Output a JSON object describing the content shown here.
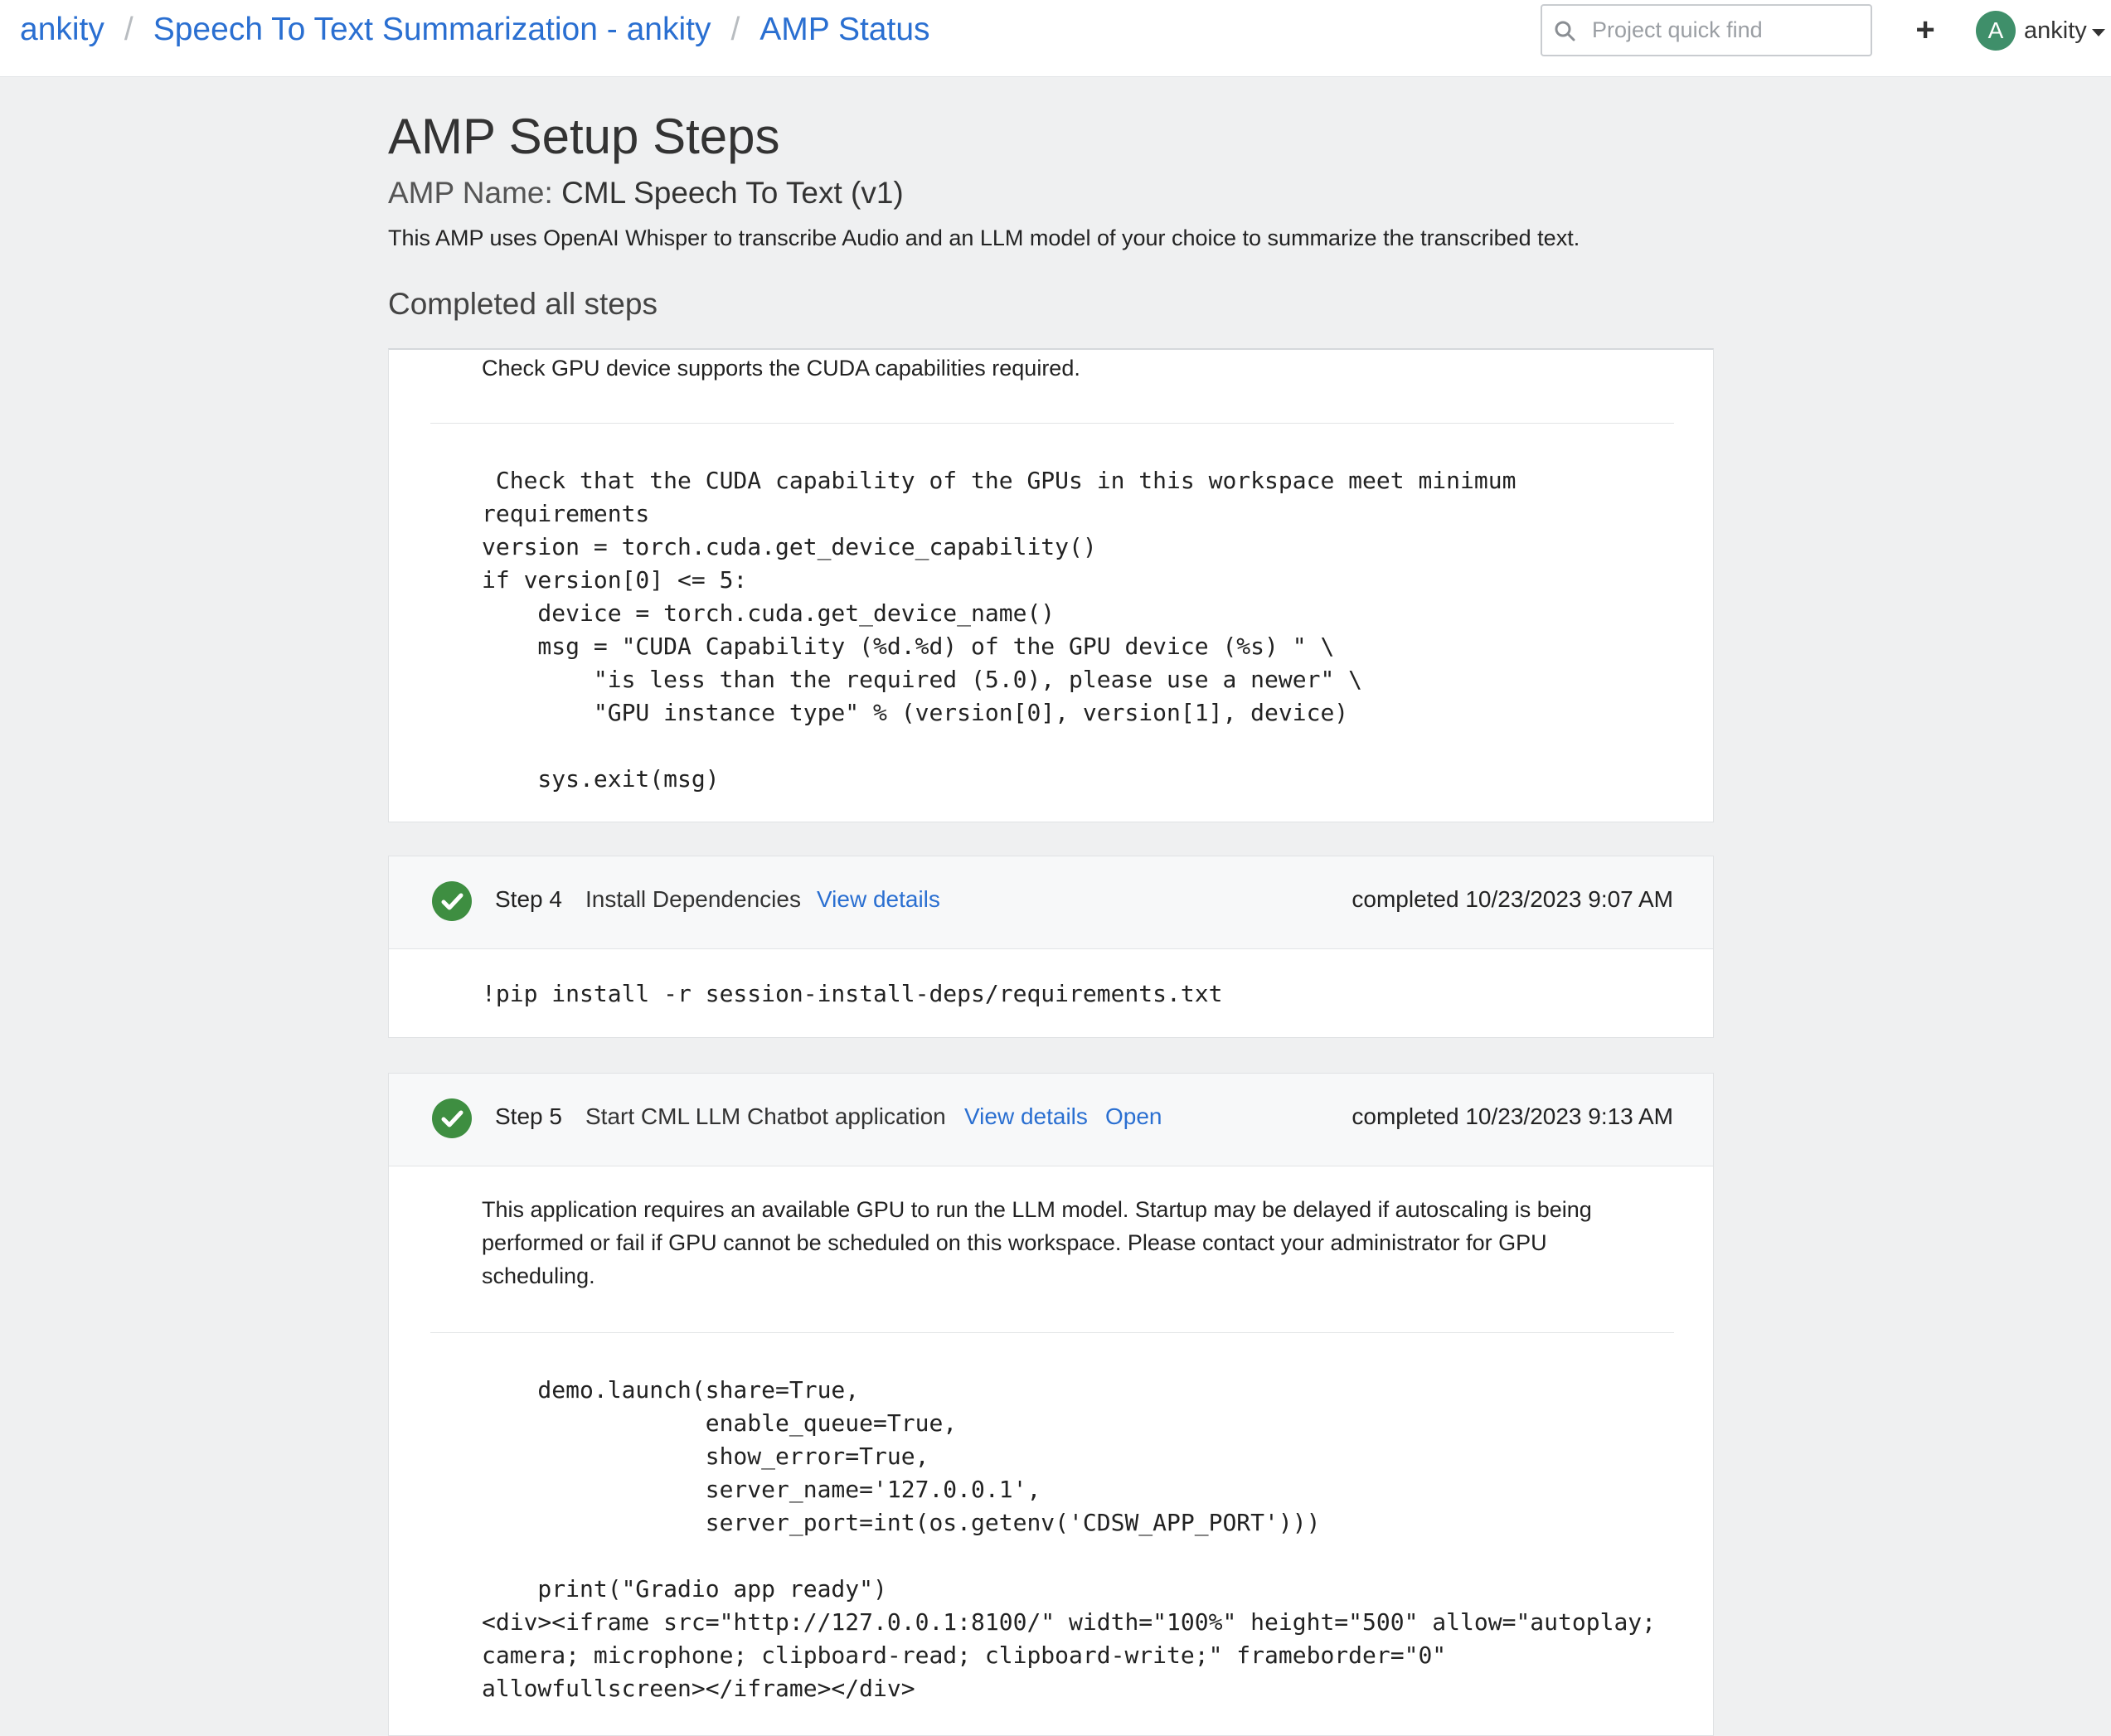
{
  "breadcrumb": {
    "items": [
      "ankity",
      "Speech To Text Summarization - ankity",
      "AMP Status"
    ],
    "separator": "/"
  },
  "search": {
    "placeholder": "Project quick find"
  },
  "header": {
    "add_icon": "+",
    "user_initial": "A",
    "user_name": "ankity"
  },
  "page": {
    "title": "AMP Setup Steps",
    "amp_name_label": "AMP Name:",
    "amp_name_value": "CML Speech To Text (v1)",
    "description": "This AMP uses OpenAI Whisper to transcribe Audio and an LLM model of your choice to summarize the transcribed text.",
    "status": "Completed all steps"
  },
  "step3_partial": {
    "description": "Check GPU device supports the CUDA capabilities required.",
    "code": " Check that the CUDA capability of the GPUs in this workspace meet minimum\nrequirements\nversion = torch.cuda.get_device_capability()\nif version[0] <= 5:\n    device = torch.cuda.get_device_name()\n    msg = \"CUDA Capability (%d.%d) of the GPU device (%s) \" \\\n        \"is less than the required (5.0), please use a newer\" \\\n        \"GPU instance type\" % (version[0], version[1], device)\n\n    sys.exit(msg)"
  },
  "step4": {
    "number": "Step 4",
    "title": "Install Dependencies",
    "view_details": "View details",
    "status": "completed 10/23/2023 9:07 AM",
    "code": "!pip install -r session-install-deps/requirements.txt"
  },
  "step5": {
    "number": "Step 5",
    "title": "Start CML LLM Chatbot application",
    "view_details": "View details",
    "open": "Open",
    "status": "completed 10/23/2023 9:13 AM",
    "description": "This application requires an available GPU to run the LLM model. Startup may be delayed if autoscaling is being\nperformed or fail if GPU cannot be scheduled on this workspace. Please contact your administrator for GPU\nscheduling.",
    "code": "    demo.launch(share=True,\n                enable_queue=True,\n                show_error=True,\n                server_name='127.0.0.1',\n                server_port=int(os.getenv('CDSW_APP_PORT')))\n\n    print(\"Gradio app ready\")\n<div><iframe src=\"http://127.0.0.1:8100/\" width=\"100%\" height=\"500\" allow=\"autoplay;\ncamera; microphone; clipboard-read; clipboard-write;\" frameborder=\"0\"\nallowfullscreen></iframe></div>"
  },
  "colors": {
    "link": "#2a6fd1",
    "success": "#3e8e41",
    "avatar": "#3f8f6a"
  }
}
